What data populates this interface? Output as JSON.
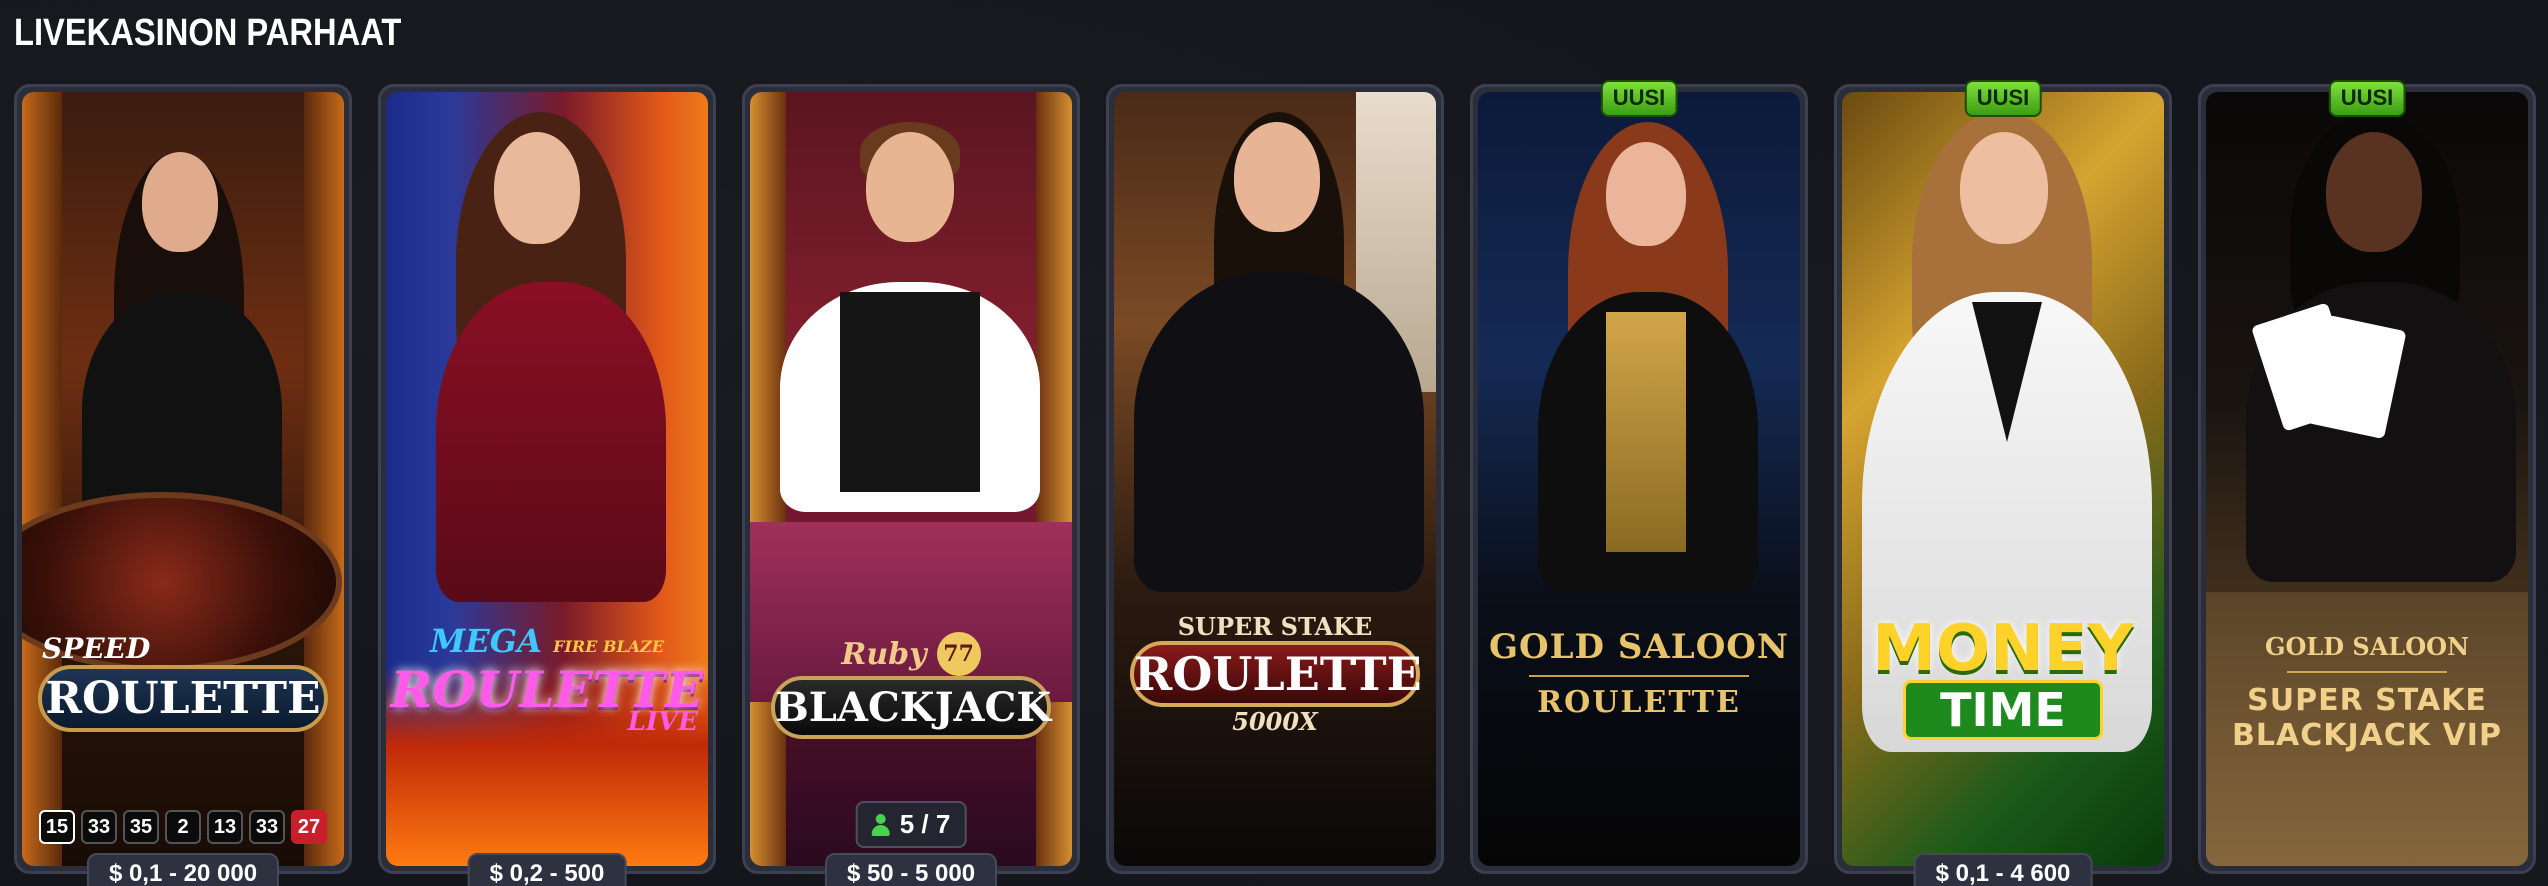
{
  "section": {
    "title": "LIVEKASINON PARHAAT"
  },
  "cards": [
    {
      "logo_top": "SPEED",
      "logo_main": "ROULETTE",
      "results": [
        "15",
        "33",
        "35",
        "2",
        "13",
        "33",
        "27"
      ],
      "limit": "$ 0,1 - 20 000"
    },
    {
      "logo_top": "MEGA",
      "logo_sub": "FIRE BLAZE",
      "logo_main": "ROULETTE",
      "logo_tail": "LIVE",
      "limit": "$ 0,2 - 500"
    },
    {
      "logo_top": "Ruby",
      "logo_main": "BLACKJACK",
      "logo_num": "77",
      "seats": "5 / 7",
      "limit": "$ 50 - 5 000"
    },
    {
      "logo_top": "SUPER STAKE",
      "logo_main": "ROULETTE",
      "logo_sub": "5000X"
    },
    {
      "badge": "UUSI",
      "logo_top": "GOLD SALOON",
      "logo_main": "ROULETTE"
    },
    {
      "badge": "UUSI",
      "logo_top": "MONEY",
      "logo_main": "TIME",
      "limit": "$ 0,1 - 4 600"
    },
    {
      "badge": "UUSI",
      "logo_top": "GOLD SALOON",
      "logo_main": "SUPER STAKE",
      "logo_sub": "BLACKJACK VIP"
    }
  ]
}
